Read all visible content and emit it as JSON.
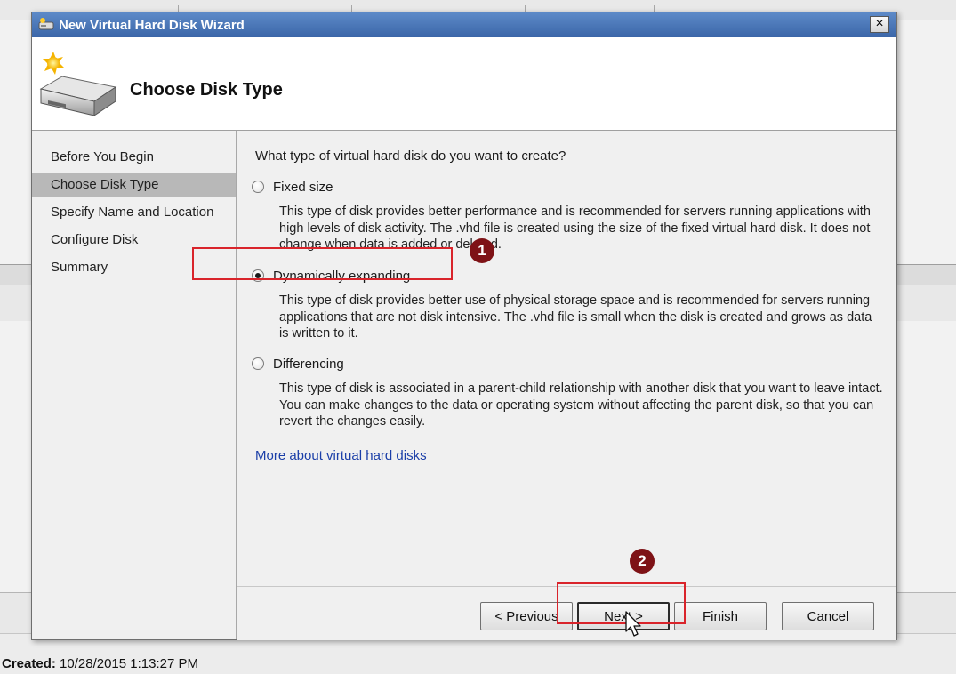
{
  "dialog": {
    "title": "New Virtual Hard Disk Wizard",
    "close_label": "×",
    "header_title": "Choose Disk Type"
  },
  "nav": {
    "items": [
      {
        "label": "Before You Begin",
        "active": false
      },
      {
        "label": "Choose Disk Type",
        "active": true
      },
      {
        "label": "Specify Name and Location",
        "active": false
      },
      {
        "label": "Configure Disk",
        "active": false
      },
      {
        "label": "Summary",
        "active": false
      }
    ]
  },
  "content": {
    "question": "What type of virtual hard disk do you want to create?",
    "options": [
      {
        "label": "Fixed size",
        "checked": false,
        "description": "This type of disk provides better performance and is recommended for servers running applications with high levels of disk activity. The .vhd file is created using the size of the fixed virtual hard disk. It does not change when data is added or deleted."
      },
      {
        "label": "Dynamically expanding",
        "checked": true,
        "description": "This type of disk provides better use of physical storage space and is recommended for servers running applications that are not disk intensive. The .vhd file is small when the disk is created and grows as data is written to it."
      },
      {
        "label": "Differencing",
        "checked": false,
        "description": "This type of disk is associated in a parent-child relationship with another disk that you want to leave intact. You can make changes to the data or operating system without affecting the parent disk, so that you can revert the changes easily."
      }
    ],
    "link": "More about virtual hard disks"
  },
  "buttons": {
    "previous": "< Previous",
    "next": "Next >",
    "finish": "Finish",
    "cancel": "Cancel"
  },
  "annotations": {
    "badge1": "1",
    "badge2": "2",
    "color": "#d9242b",
    "badge_color": "#7e1216"
  },
  "background": {
    "created_label": "Created:",
    "created_value": "10/28/2015 1:13:27 PM"
  },
  "colors": {
    "titlebar": "#3b66a8",
    "link": "#1a3ea8",
    "nav_active": "#b8b8b8"
  }
}
